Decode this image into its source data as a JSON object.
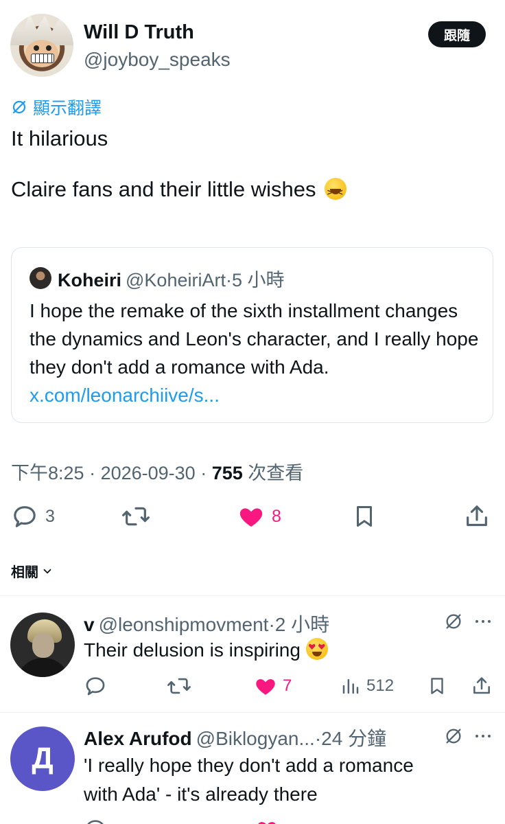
{
  "tweet": {
    "author_name": "Will D Truth",
    "author_handle": "@joyboy_speaks",
    "follow_label": "跟隨",
    "translate_label": "顯示翻譯",
    "line1": "It hilarious",
    "line2": "Claire fans and their little wishes",
    "emoji_name": "grinning-squinting-face-emoji",
    "quote": {
      "name": "Koheiri",
      "handle": "@KoheiriArt",
      "time": "5 小時",
      "text": "I hope the remake of the sixth installment changes the dynamics and Leon's character, and I really hope they don't add a romance with Ada.",
      "link": "x.com/leonarchiive/s..."
    },
    "time": "下午8:25",
    "date": "2026-09-30",
    "views_count": "755",
    "views_label": "次查看",
    "replies": "3",
    "likes": "8",
    "accent_color": "#1d9bf0",
    "like_color": "#f91880"
  },
  "related_label": "相關",
  "replies": [
    {
      "name": "v",
      "handle": "@leonshipmovment",
      "time": "2 小時",
      "text": "Their delusion is inspiring",
      "emoji_name": "smiling-face-with-heart-eyes-emoji",
      "likes": "7",
      "views": "512"
    },
    {
      "name": "Alex Arufod",
      "handle": "@Biklogyan...",
      "time": "24 分鐘",
      "avatar_letter": "Д",
      "text_line1": "'I really hope they don't add a romance",
      "text_line2": "with Ada' - it's already there"
    }
  ]
}
